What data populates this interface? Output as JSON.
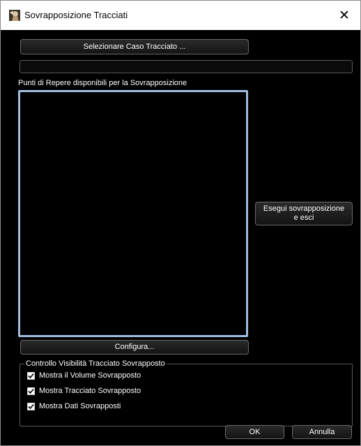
{
  "window": {
    "title": "Sovrapposizione Tracciati",
    "close_glyph": "✕",
    "app_icon": "app-logo-icon"
  },
  "main": {
    "select_case_button": "Selezionare Caso Tracciato ...",
    "selected_case_value": "",
    "landmarks_label": "Punti di Repere disponibili per la Sovrapposizione",
    "landmarks_items": [],
    "execute_button_line1": "Esegui sovrapposizione",
    "execute_button_line2": "e esci",
    "configure_button": "Configura..."
  },
  "visibility_group": {
    "title": "Controllo Visibilità Tracciato Sovrapposto",
    "options": [
      {
        "label": "Mostra il Volume Sovrapposto",
        "checked": true
      },
      {
        "label": "Mostra Tracciato Sovrapposto",
        "checked": true
      },
      {
        "label": "Mostra Dati Sovrapposti",
        "checked": true
      }
    ]
  },
  "footer": {
    "ok_button": "OK",
    "cancel_button": "Annulla"
  },
  "colors": {
    "background": "#000000",
    "listbox_border": "#9fbde0",
    "titlebar": "#ffffff"
  }
}
